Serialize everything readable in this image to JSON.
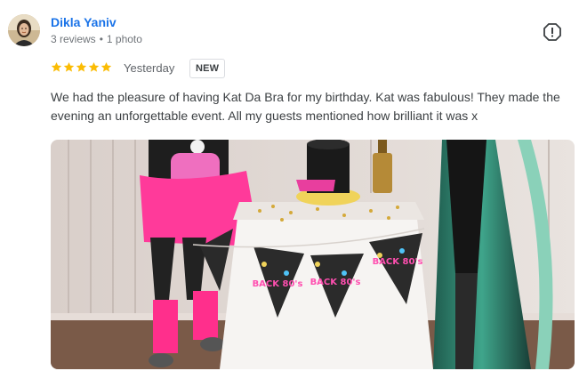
{
  "reviewer": {
    "name": "Dikla Yaniv",
    "reviews_count": "3 reviews",
    "photos_count": "1 photo"
  },
  "review": {
    "rating": 5,
    "max_rating": 5,
    "date": "Yesterday",
    "badge": "NEW",
    "text": "We had the pleasure of having Kat Da Bra for my birthday. Kat was fabulous! They made the evening an unforgettable event. All my guests mentioned how brilliant it was x"
  },
  "photo": {
    "bunting_text": [
      "BACK 80's",
      "BACK 80's",
      "BACK 80's"
    ]
  },
  "colors": {
    "name_link": "#1a73e8",
    "star": "#fbbc04",
    "meta_text": "#70757a"
  },
  "icons": {
    "report": "report-flag-icon",
    "star": "star-icon"
  }
}
